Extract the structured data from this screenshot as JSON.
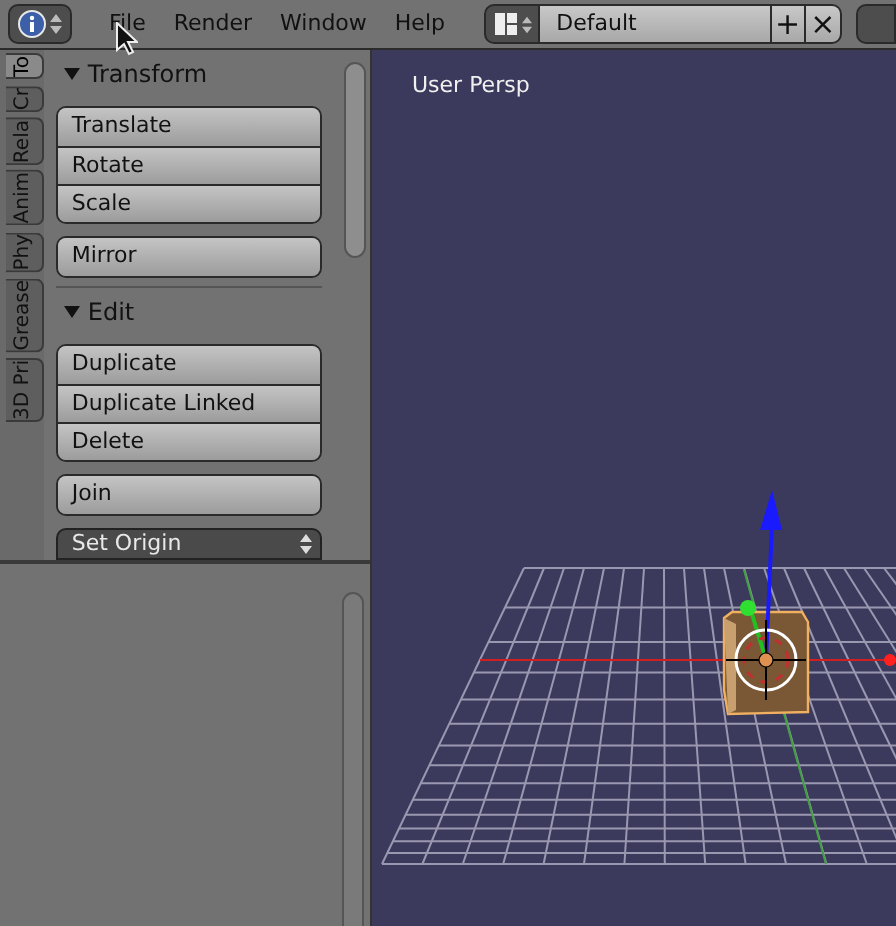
{
  "top_bar": {
    "menus": [
      "File",
      "Render",
      "Window",
      "Help"
    ],
    "layout_name": "Default",
    "add_symbol": "+",
    "remove_symbol": "×"
  },
  "tool_tabs": [
    {
      "label": "To",
      "selected": true
    },
    {
      "label": "Cr",
      "selected": false
    },
    {
      "label": "Rela",
      "selected": false
    },
    {
      "label": "Anim",
      "selected": false
    },
    {
      "label": "Phy",
      "selected": false
    },
    {
      "label": "Grease",
      "selected": false
    },
    {
      "label": "3D Pri",
      "selected": false
    }
  ],
  "panels": [
    {
      "title": "Transform",
      "expanded": true,
      "groups": [
        {
          "kind": "buttons",
          "items": [
            "Translate",
            "Rotate",
            "Scale"
          ]
        },
        {
          "kind": "buttons",
          "items": [
            "Mirror"
          ]
        }
      ]
    },
    {
      "title": "Edit",
      "expanded": true,
      "groups": [
        {
          "kind": "buttons",
          "items": [
            "Duplicate",
            "Duplicate Linked",
            "Delete"
          ]
        },
        {
          "kind": "buttons",
          "items": [
            "Join"
          ]
        },
        {
          "kind": "dropdown",
          "items": [
            "Set Origin"
          ]
        }
      ]
    }
  ],
  "viewport": {
    "label": "User Persp"
  }
}
